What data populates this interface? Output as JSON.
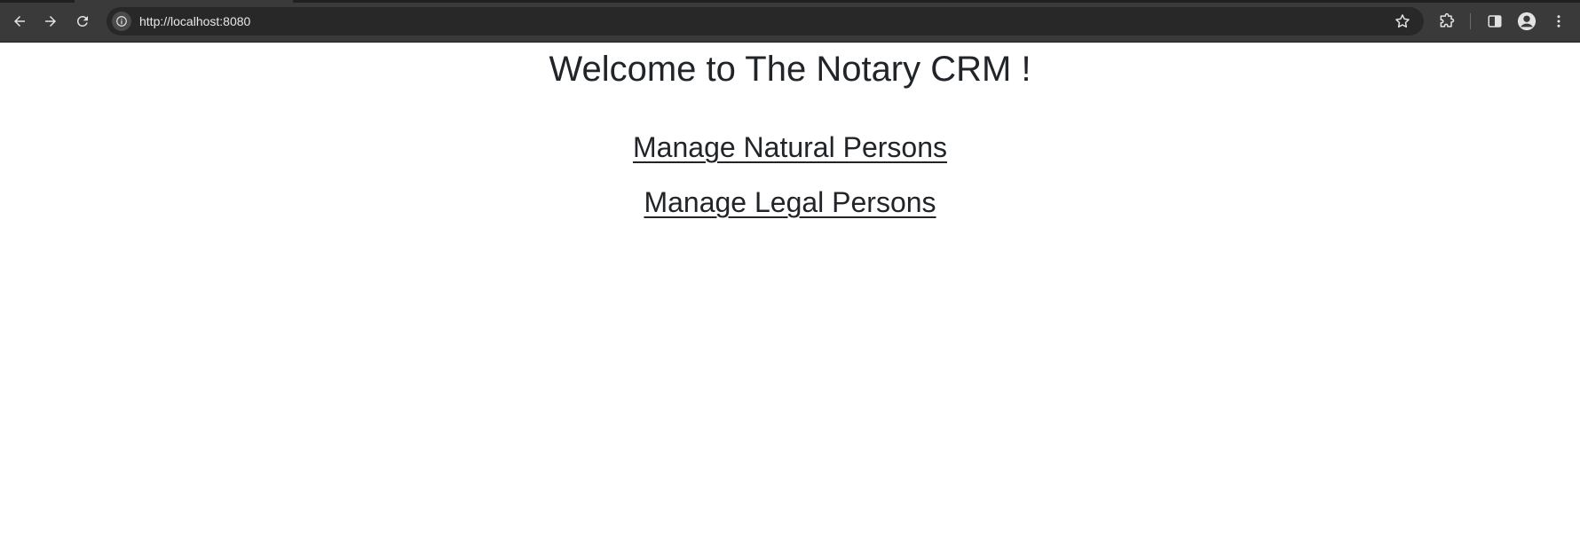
{
  "browser": {
    "url": "http://localhost:8080",
    "icons": {
      "back": "arrow-left-icon",
      "forward": "arrow-right-icon",
      "reload": "reload-icon",
      "site_info": "info-icon",
      "bookmark": "star-icon",
      "extensions": "puzzle-icon",
      "side_panel": "side-panel-icon",
      "profile": "profile-icon",
      "menu": "kebab-menu-icon"
    },
    "colors": {
      "toolbar": "#3a3a3a",
      "omnibox": "#282828",
      "icon": "#e3e3e3"
    }
  },
  "page": {
    "heading": "Welcome to The Notary CRM !",
    "links": [
      {
        "label": "Manage Natural Persons"
      },
      {
        "label": "Manage Legal Persons"
      }
    ],
    "colors": {
      "text": "#212529",
      "background": "#ffffff"
    }
  }
}
